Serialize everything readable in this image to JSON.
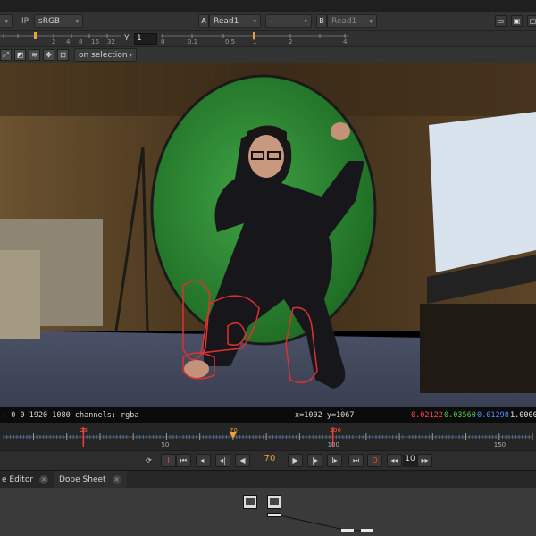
{
  "viewer_header": {
    "ip_label": "IP",
    "colorspace": "sRGB",
    "a_label": "A",
    "a_input": "Read1",
    "operation": "-",
    "b_label": "B",
    "b_input": "Read1"
  },
  "row2": {
    "gain_ticks": [
      "2",
      "4",
      "8",
      "16",
      "32"
    ],
    "gamma_label": "Y",
    "gamma_value": "1",
    "gamma_ticks": [
      "0",
      "0.1",
      "0.5",
      "1",
      "2",
      "4"
    ]
  },
  "row3": {
    "mode_dropdown": "on selection",
    "icons": [
      "fit-icon",
      "wipe-icon",
      "proxy-icon",
      "transform-icon",
      "roi-icon"
    ]
  },
  "info_bar": {
    "format": ": 0 0 1920 1080  channels: rgba",
    "coords": "x=1002 y=1067",
    "r": "0.02122",
    "g": "0.03560",
    "b": "0.01298",
    "a": "1.00000",
    "colors": {
      "r": "#ff4d4d",
      "g": "#4dd24d",
      "b": "#5a8cff",
      "a": "#e6e6e6"
    }
  },
  "timeline": {
    "in_marker": "25",
    "current_marker": "70",
    "out_marker": "100",
    "ticks": [
      "50",
      "100",
      "150"
    ],
    "range_start": 1,
    "range_end": 160
  },
  "transport": {
    "current_frame": "70",
    "increment": "10"
  },
  "tabs": [
    {
      "label": "e Editor"
    },
    {
      "label": "Dope Sheet"
    }
  ],
  "colors": {
    "panel": "#2b2b2b",
    "accent_orange": "#e8a23c",
    "playhead_red": "#ff3a3a"
  }
}
